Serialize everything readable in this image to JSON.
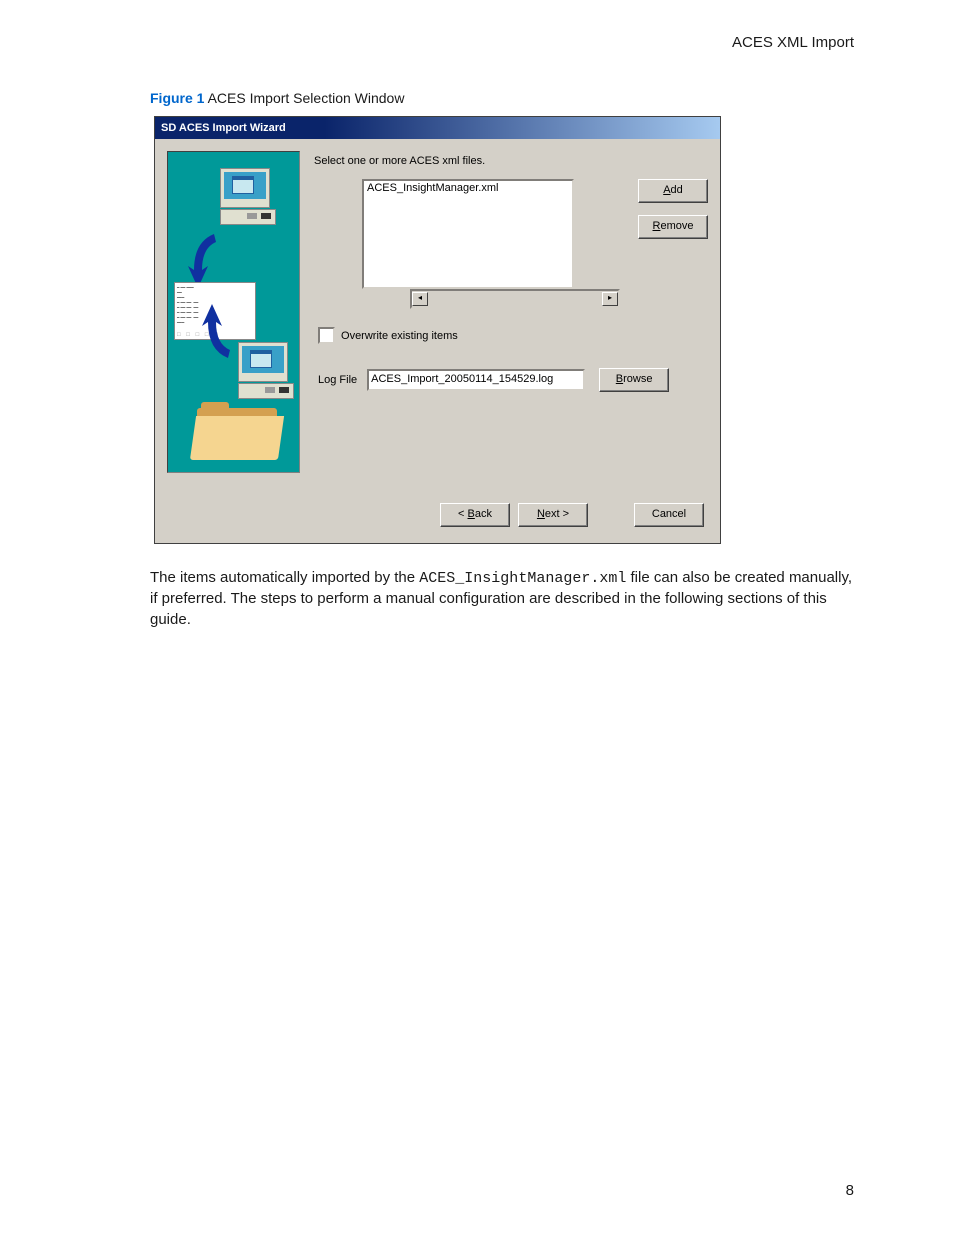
{
  "header": {
    "section": "ACES XML Import"
  },
  "figure": {
    "label": "Figure 1",
    "caption": "ACES Import Selection Window"
  },
  "dialog": {
    "title": "SD ACES Import Wizard",
    "instruction": "Select one or more ACES xml files.",
    "file_list": {
      "items": [
        "ACES_InsightManager.xml"
      ]
    },
    "buttons": {
      "add": "Add",
      "add_ul": "A",
      "remove": "emove",
      "remove_ul": "R",
      "browse": "rowse",
      "browse_ul": "B",
      "back": "ack",
      "back_pre": "< ",
      "back_ul": "B",
      "next": "ext >",
      "next_ul": "N",
      "cancel": "Cancel"
    },
    "overwrite": {
      "label": "verwrite existing items",
      "ul": "O",
      "checked": false
    },
    "logfile": {
      "label": "Log File",
      "value": "ACES_Import_20050114_154529.log"
    }
  },
  "body": {
    "p1a": "The items automatically imported by the ",
    "p1code": "ACES_InsightManager.xml",
    "p1b": " file can also be created manually, if preferred. The steps to perform a manual configuration are described in the following sections of this guide."
  },
  "pagenum": "8"
}
